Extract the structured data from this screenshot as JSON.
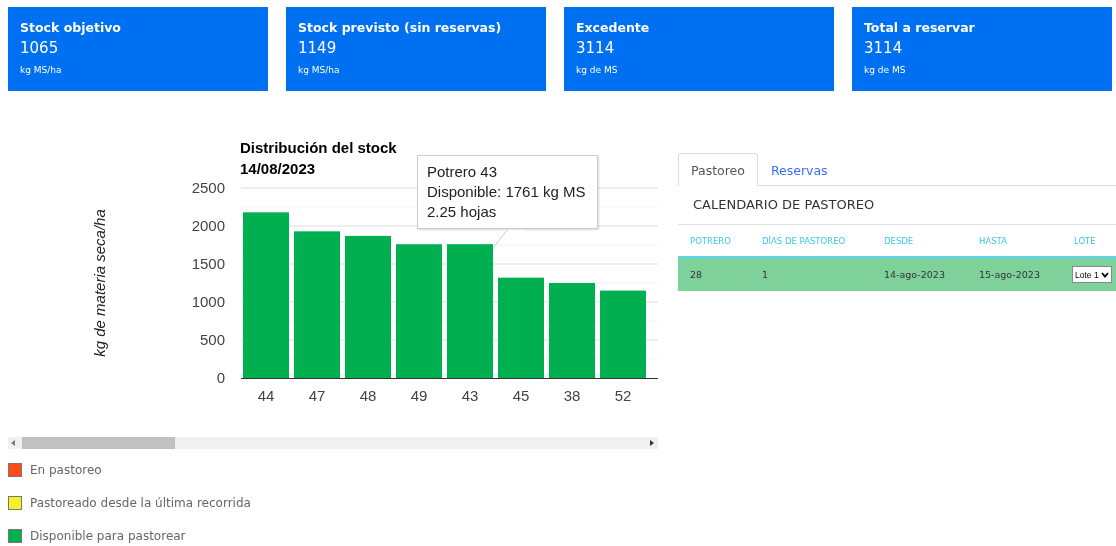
{
  "summary_cards": [
    {
      "title": "Stock objetivo",
      "value": "1065",
      "unit": "kg MS/ha"
    },
    {
      "title": "Stock previsto (sin reservas)",
      "value": "1149",
      "unit": "kg MS/ha"
    },
    {
      "title": "Excedente",
      "value": "3114",
      "unit": "kg de MS"
    },
    {
      "title": "Total a reservar",
      "value": "3114",
      "unit": "kg de MS"
    }
  ],
  "stock_chart": {
    "chart_data": {
      "type": "bar",
      "title": "Distribución del stock",
      "subtitle": "14/08/2023",
      "annotations": [
        {
          "text": "kg de materia seca/ha"
        }
      ],
      "categories": [
        "44",
        "47",
        "48",
        "49",
        "43",
        "45",
        "38",
        "52"
      ],
      "series": [
        {
          "color": "#00b050",
          "values": [
            2180,
            1930,
            1870,
            1760,
            1761,
            1320,
            1250,
            1150
          ]
        }
      ],
      "ylim": [
        0,
        2500
      ],
      "yticks": [
        0,
        500,
        1000,
        1500,
        2000,
        2500
      ],
      "grid": true
    },
    "tooltip": {
      "lines": [
        "Potrero 43",
        "Disponible: 1761 kg MS",
        "2.25 hojas"
      ]
    }
  },
  "legend": [
    {
      "label": "En pastoreo",
      "color": "#ff4d1a"
    },
    {
      "label": "Pastoreado desde la última recorrida",
      "color": "#f5f028"
    },
    {
      "label": "Disponible para pastorear",
      "color": "#00b050"
    }
  ],
  "tabs": [
    {
      "label": "Pastoreo",
      "selected": true
    },
    {
      "label": "Reservas",
      "selected": false
    }
  ],
  "calendar": {
    "title": "CALENDARIO DE PASTOREO",
    "columns": [
      "POTRERO",
      "DÍAS DE PASTOREO",
      "DESDE",
      "HASTA",
      "LOTE"
    ],
    "rows": [
      {
        "potrero": "28",
        "dias": "1",
        "desde": "14-ago-2023",
        "hasta": "15-ago-2023",
        "lote": "Lote 1",
        "selected": true
      }
    ]
  }
}
